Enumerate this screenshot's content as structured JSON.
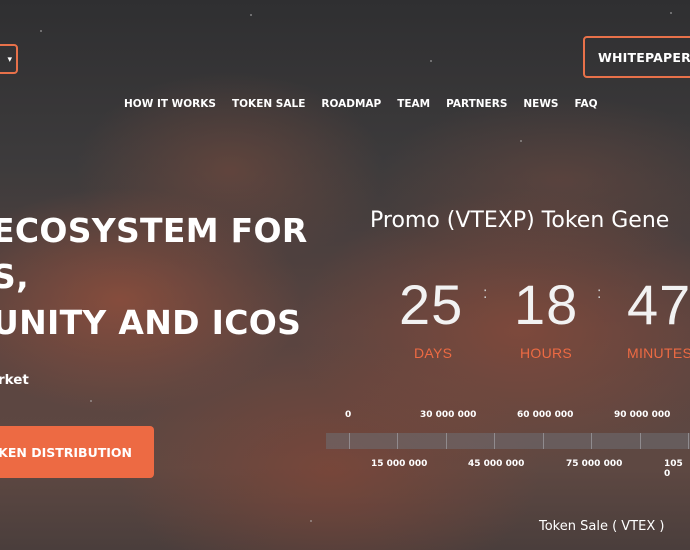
{
  "header": {
    "lang_select_caret": "▾",
    "whitepaper_label": "WHITEPAPER"
  },
  "nav": {
    "items": [
      "HOW IT WORKS",
      "TOKEN SALE",
      "ROADMAP",
      "TEAM",
      "PARTNERS",
      "NEWS",
      "FAQ"
    ]
  },
  "hero": {
    "title_lines": [
      "ECOSYSTEM FOR",
      "S,",
      "UNITY AND ICOS"
    ],
    "subtitle": "rket",
    "cta_label": "OKEN DISTRIBUTION"
  },
  "promo": {
    "title": "Promo (VTEXP) Token Gene",
    "countdown": {
      "days": "25",
      "hours": "18",
      "minutes": "47",
      "separator": ":",
      "days_label": "DAYS",
      "hours_label": "HOURS",
      "minutes_label": "MINUTES"
    },
    "scale_top": [
      "0",
      "30 000 000",
      "60 000 000",
      "90 000 000"
    ],
    "scale_bottom": [
      "15 000 000",
      "45 000 000",
      "75 000 000",
      "105 0"
    ],
    "token_sale_label": "Token Sale ( VTEX )"
  },
  "colors": {
    "accent": "#ed6a43"
  }
}
